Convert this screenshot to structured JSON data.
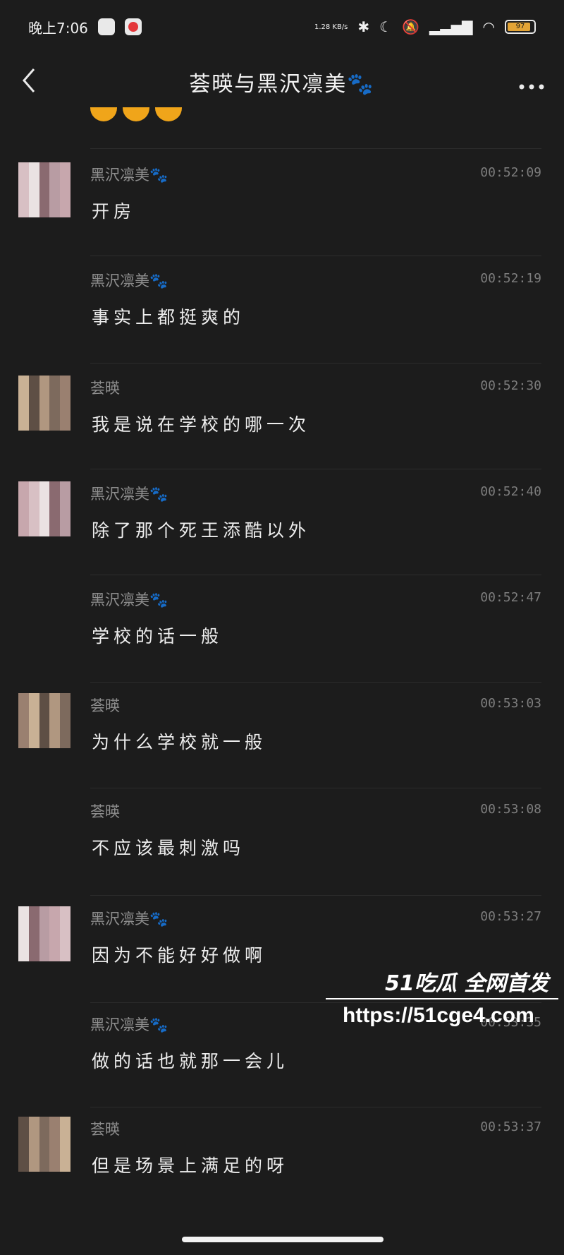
{
  "status": {
    "time": "晚上7:06",
    "net_speed": "1.28 KB/s",
    "battery": "97"
  },
  "nav": {
    "title": "荟暎与黑沢凛美🐾",
    "back_icon": "chevron-left-icon",
    "more_icon": "more-dots-icon"
  },
  "messages": [
    {
      "sender": "黑沢凛美🐾",
      "time": "00:52:09",
      "text": "开房",
      "avatar": true
    },
    {
      "sender": "黑沢凛美🐾",
      "time": "00:52:19",
      "text": "事实上都挺爽的",
      "avatar": false
    },
    {
      "sender": "荟暎",
      "time": "00:52:30",
      "text": "我是说在学校的哪一次",
      "avatar": true
    },
    {
      "sender": "黑沢凛美🐾",
      "time": "00:52:40",
      "text": "除了那个死王添酷以外",
      "avatar": true
    },
    {
      "sender": "黑沢凛美🐾",
      "time": "00:52:47",
      "text": "学校的话一般",
      "avatar": false
    },
    {
      "sender": "荟暎",
      "time": "00:53:03",
      "text": "为什么学校就一般",
      "avatar": true
    },
    {
      "sender": "荟暎",
      "time": "00:53:08",
      "text": "不应该最刺激吗",
      "avatar": false
    },
    {
      "sender": "黑沢凛美🐾",
      "time": "00:53:27",
      "text": "因为不能好好做啊",
      "avatar": true
    },
    {
      "sender": "黑沢凛美🐾",
      "time": "00:53:35",
      "text": "做的话也就那一会儿",
      "avatar": false
    },
    {
      "sender": "荟暎",
      "time": "00:53:37",
      "text": "但是场景上满足的呀",
      "avatar": true
    }
  ],
  "watermark": {
    "brand": "51吃瓜 全网首发",
    "url": "https://51cge4.com"
  }
}
